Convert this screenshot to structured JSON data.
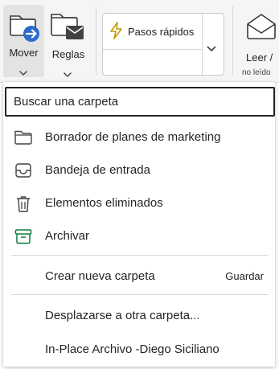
{
  "ribbon": {
    "move_label": "Mover",
    "rules_label": "Reglas",
    "quick_steps_label": "Pasos rápidos",
    "read_label": "Leer /",
    "read_sub": "no leído",
    "colors": {
      "accent": "#2b6bc9",
      "ribbon_bg": "#f5f5f5",
      "bolt": "#c19c00"
    }
  },
  "dropdown": {
    "search_placeholder": "Buscar una carpeta",
    "folders": [
      {
        "label": "Borrador de planes de marketing",
        "icon": "folder-icon"
      },
      {
        "label": "Bandeja de entrada",
        "icon": "inbox-icon"
      },
      {
        "label": "Elementos eliminados",
        "icon": "trash-icon"
      },
      {
        "label": "Archivar",
        "icon": "archive-icon"
      }
    ],
    "new_folder": {
      "label": "Crear nueva carpeta",
      "shortcut": "Guardar"
    },
    "other_folder_label": "Desplazarse a otra carpeta...",
    "archive_mailbox_label": "In-Place Archivo -Diego Siciliano",
    "archive_icon_color": "#107c41"
  }
}
